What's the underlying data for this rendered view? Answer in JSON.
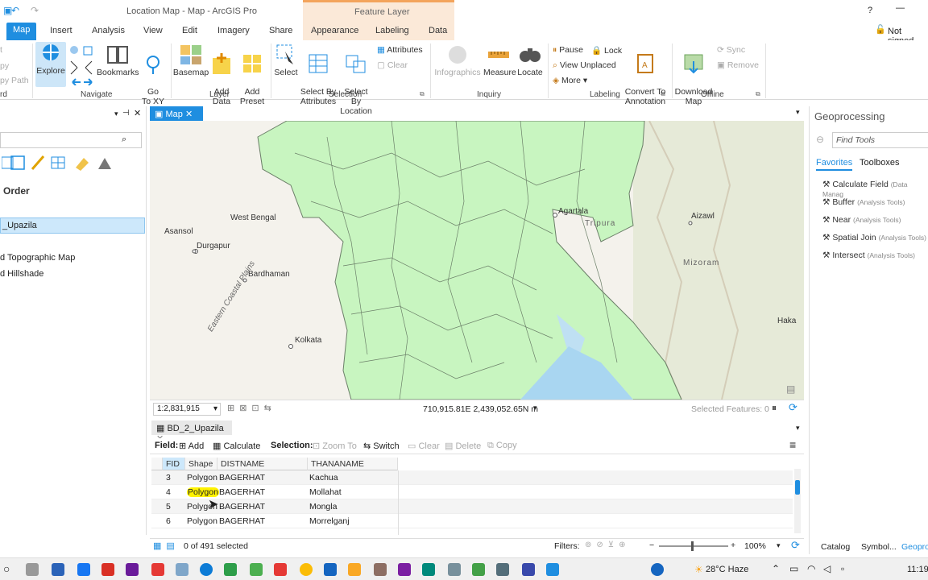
{
  "window": {
    "title": "Location Map - Map - ArcGIS Pro",
    "context_tab": "Feature Layer",
    "help": "?",
    "minimize": "—",
    "signin": "Not signed"
  },
  "ribbon_tabs": [
    "Map",
    "Insert",
    "Analysis",
    "View",
    "Edit",
    "Imagery",
    "Share",
    "Appearance",
    "Labeling",
    "Data"
  ],
  "ribbon": {
    "clip": {
      "a": "t",
      "b": "py",
      "c": "py Path",
      "label": "rd"
    },
    "navigate": {
      "explore": "Explore",
      "bookmarks": "Bookmarks",
      "goto": "Go\nTo XY",
      "label": "Navigate"
    },
    "layer": {
      "basemap": "Basemap",
      "add_data": "Add\nData",
      "add_preset": "Add\nPreset",
      "label": "Layer"
    },
    "selection": {
      "select": "Select",
      "by_attr": "Select By\nAttributes",
      "by_loc": "Select By\nLocation",
      "attributes": "Attributes",
      "clear": "Clear",
      "label": "Selection"
    },
    "inquiry": {
      "infographics": "Infographics",
      "measure": "Measure",
      "locate": "Locate",
      "label": "Inquiry"
    },
    "labeling": {
      "pause": "Pause",
      "lock": "Lock",
      "view_unplaced": "View Unplaced",
      "more": "More",
      "convert": "Convert To\nAnnotation",
      "label": "Labeling"
    },
    "offline": {
      "download": "Download\nMap",
      "sync": "Sync",
      "remove": "Remove",
      "label": "Offline"
    }
  },
  "left_pane": {
    "drawing_order": "Order",
    "layer_selected": "_Upazila",
    "item1": "d Topographic Map",
    "item2": "d Hillshade"
  },
  "map_tab": "Map",
  "map_labels": [
    "West Bengal",
    "Asansol",
    "Durgapur",
    "Bardhaman",
    "Kolkata",
    "Eastern Coastal Plains",
    "Agartala",
    "Tripura",
    "Aizawl",
    "Mizoram",
    "Haka"
  ],
  "map_status": {
    "scale": "1:2,831,915",
    "coords": "710,915.81E 2,439,052.65N m",
    "selected": "Selected Features: 0"
  },
  "table": {
    "tab": "BD_2_Upazila",
    "field_label": "Field:",
    "add": "Add",
    "calculate": "Calculate",
    "selection_label": "Selection:",
    "zoom_to": "Zoom To",
    "switch": "Switch",
    "clear": "Clear",
    "delete": "Delete",
    "copy": "Copy",
    "columns": [
      "FID",
      "Shape",
      "DISTNAME",
      "THANANAME"
    ],
    "rows": [
      {
        "fid": "3",
        "shape": "Polygon",
        "dist": "BAGERHAT",
        "thana": "Kachua"
      },
      {
        "fid": "4",
        "shape": "Polygon",
        "dist": "BAGERHAT",
        "thana": "Mollahat"
      },
      {
        "fid": "5",
        "shape": "Polygon",
        "dist": "BAGERHAT",
        "thana": "Mongla"
      },
      {
        "fid": "6",
        "shape": "Polygon",
        "dist": "BAGERHAT",
        "thana": "Morrelganj"
      }
    ],
    "status": "0 of 491 selected",
    "filters": "Filters:",
    "zoom": "100%"
  },
  "geoprocessing": {
    "title": "Geoprocessing",
    "search_placeholder": "Find Tools",
    "tab_favorites": "Favorites",
    "tab_toolboxes": "Toolboxes",
    "tools": [
      {
        "name": "Calculate Field",
        "box": "(Data Manag"
      },
      {
        "name": "Buffer",
        "box": "(Analysis Tools)"
      },
      {
        "name": "Near",
        "box": "(Analysis Tools)"
      },
      {
        "name": "Spatial Join",
        "box": "(Analysis Tools)"
      },
      {
        "name": "Intersect",
        "box": "(Analysis Tools)"
      }
    ],
    "bottom_tabs": [
      "Catalog",
      "Symbol...",
      "Geopro..."
    ]
  },
  "taskbar": {
    "weather": "28°C Haze",
    "time": "11:19"
  },
  "colors": {
    "accent": "#1f8ee0",
    "land": "#c8f5c0",
    "selected_row": "#cde8fb"
  }
}
